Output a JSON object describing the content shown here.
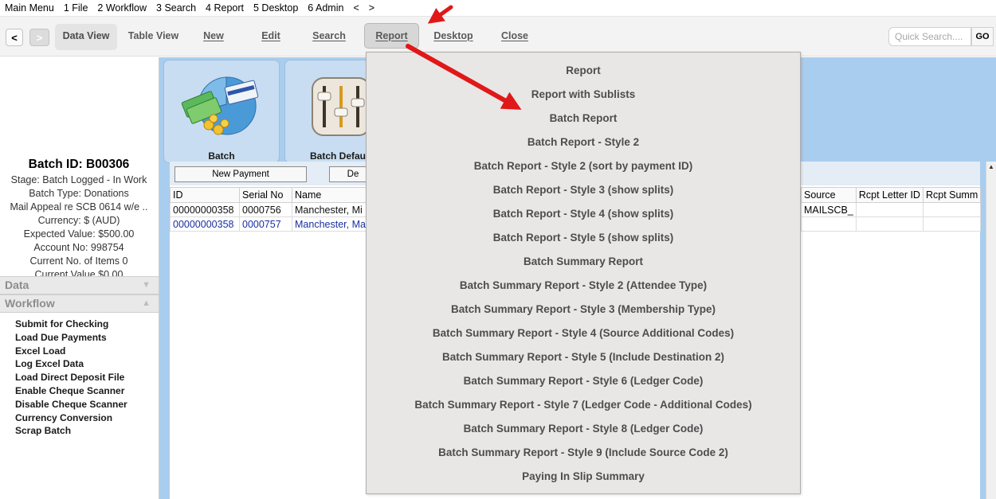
{
  "menubar": {
    "items": [
      "Main Menu",
      "1 File",
      "2 Workflow",
      "3 Search",
      "4 Report",
      "5 Desktop",
      "6 Admin",
      "<",
      ">"
    ]
  },
  "toolbar": {
    "back": "<",
    "forward": ">",
    "data_view": "Data View",
    "table_view": "Table View",
    "new": "New",
    "edit": "Edit",
    "search": "Search",
    "report": "Report",
    "desktop": "Desktop",
    "close": "Close",
    "quick_search_placeholder": "Quick Search....",
    "go": "GO"
  },
  "left": {
    "batch_id": "Batch ID: B00306",
    "lines": [
      "Stage: Batch Logged - In Work",
      "Batch Type: Donations",
      "Mail Appeal re SCB 0614 w/e ..",
      "Currency: $ (AUD)",
      "Expected Value: $500.00",
      "Account No: 998754",
      "Current No. of Items 0",
      "Current Value $0.00"
    ],
    "data_section": "Data",
    "workflow_section": "Workflow",
    "workflow_items": [
      "Submit for Checking",
      "Load Due Payments",
      "Excel Load",
      "Log Excel Data",
      "Load Direct Deposit File",
      "Enable Cheque Scanner",
      "Disable Cheque Scanner",
      "Currency Conversion",
      "Scrap Batch"
    ]
  },
  "tiles": {
    "batch": "Batch",
    "batch_default": "Batch Default"
  },
  "panel": {
    "new_payment": "New Payment",
    "de": "De"
  },
  "table": {
    "columns_left": [
      "ID",
      "Serial No",
      "Name"
    ],
    "rows_left": [
      [
        "00000000358",
        "0000756",
        "Manchester, Mi"
      ],
      [
        "00000000358",
        "0000757",
        "Manchester, Ma"
      ]
    ],
    "columns_right": [
      "Source",
      "Rcpt Letter ID",
      "Rcpt Summ"
    ],
    "rows_right": [
      [
        "MAILSCB_",
        "",
        ""
      ],
      [
        "",
        "",
        ""
      ]
    ]
  },
  "report_menu": {
    "items": [
      "Report",
      "Report with Sublists",
      "Batch Report",
      "Batch Report - Style 2",
      "Batch Report - Style 2 (sort by payment ID)",
      "Batch Report - Style 3 (show splits)",
      "Batch Report - Style 4 (show splits)",
      "Batch Report - Style 5 (show splits)",
      "Batch Summary Report",
      "Batch Summary Report - Style 2 (Attendee Type)",
      "Batch Summary Report - Style 3 (Membership Type)",
      "Batch Summary Report - Style 4 (Source Additional Codes)",
      "Batch Summary Report - Style 5 (Include Destination 2)",
      "Batch Summary Report - Style 6 (Ledger Code)",
      "Batch Summary Report - Style 7 (Ledger Code - Additional Codes)",
      "Batch Summary Report - Style 8 (Ledger Code)",
      "Batch Summary Report - Style 9 (Include Source Code 2)",
      "Paying In Slip Summary"
    ]
  },
  "colors": {
    "main_bg": "#a9cdee",
    "dropdown_bg": "#e9e6e6",
    "arrow": "#e01818"
  }
}
